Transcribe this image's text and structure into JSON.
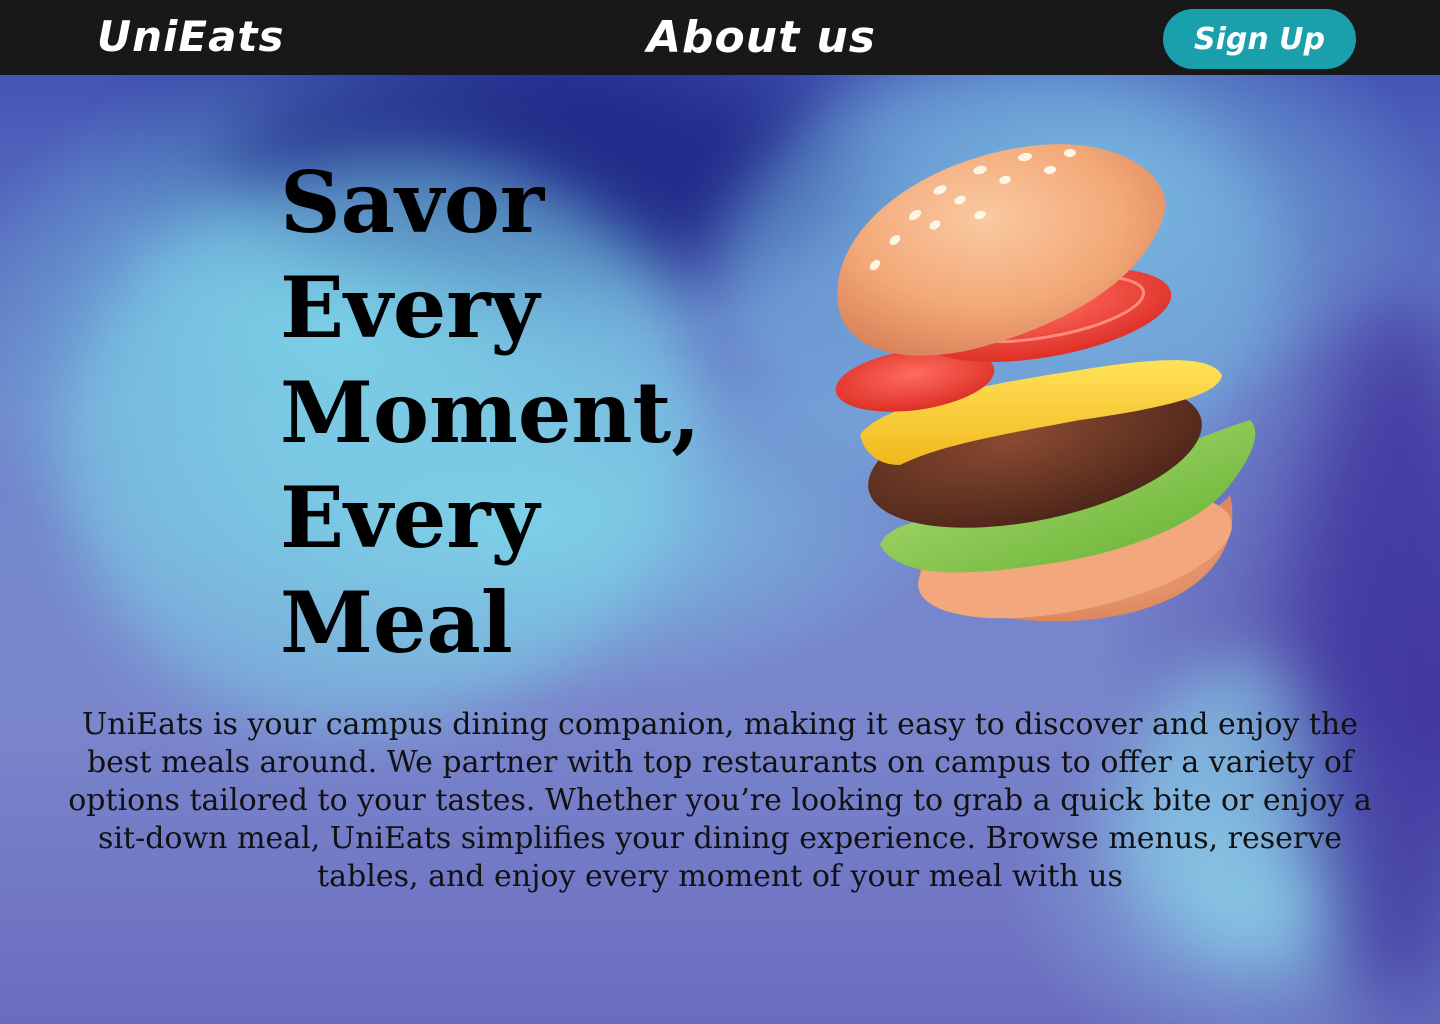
{
  "header": {
    "logo": "UniEats",
    "nav_about": "About us",
    "signup_label": "Sign Up"
  },
  "hero": {
    "title_lines": [
      "Savor",
      "Every",
      "Moment,",
      "Every",
      "Meal"
    ],
    "description": "UniEats is your campus dining companion, making it easy to discover and enjoy the best meals around. We partner with top restaurants on campus to offer a variety of options tailored to your tastes. Whether you’re looking to grab a quick bite or enjoy a sit-down meal, UniEats simplifies your dining experience. Browse menus, reserve tables, and enjoy every moment of your meal with us",
    "image_icon": "burger-illustration"
  },
  "colors": {
    "header_bg": "#181818",
    "signup_bg": "#1a9fad",
    "bg_dark": "#232d8c",
    "bg_light": "#7dd3e6"
  }
}
